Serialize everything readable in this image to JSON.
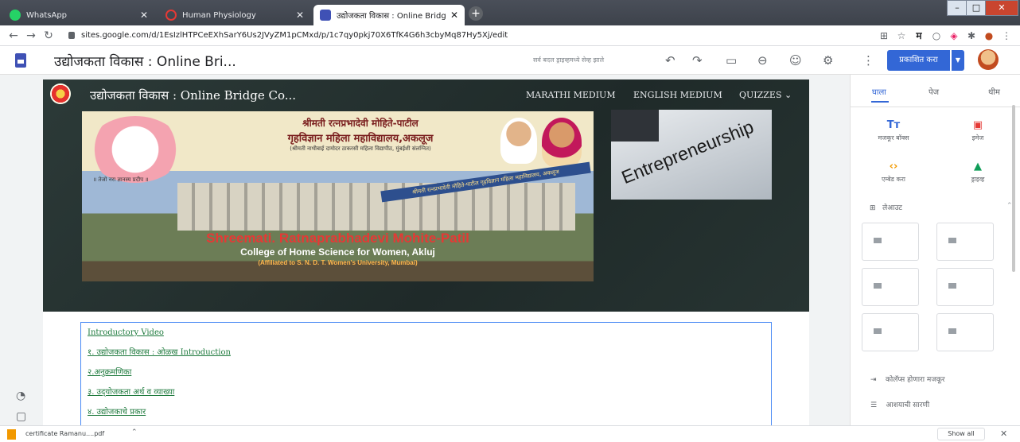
{
  "browser": {
    "tabs": [
      {
        "label": "WhatsApp",
        "color": "#25d366"
      },
      {
        "label": "Human Physiology",
        "color": "#e53935"
      },
      {
        "label": "उद्योजकता विकास : Online Bridge (",
        "color": "#3f51b5"
      }
    ],
    "new_tab": "+",
    "url": "sites.google.com/d/1EsIzlHTPCeEXhSarY6Us2JVyZM1pCMxd/p/1c7qy0pkj70X6TfK4G6h3cbyMq87Hy5Xj/edit",
    "ext_letter": "म"
  },
  "editor": {
    "title": "उद्योजकता विकास : Online Bri...",
    "save_status": "सर्व बदल ड्राइव्हमध्ये सेव्ह झाले",
    "publish_label": "प्रकाशित करा"
  },
  "site": {
    "title": "उद्योजकता विकास : Online Bridge Co...",
    "nav": [
      "MARATHI MEDIUM",
      "ENGLISH MEDIUM",
      "QUIZZES"
    ],
    "banner": {
      "hindi_line1": "श्रीमती रत्नप्रभादेवी मोहिते-पाटील",
      "hindi_line2": "गृहविज्ञान महिला महाविद्यालय,अकलूज",
      "hindi_line3": "(श्रीमती नाथीबाई दामोदर ठाकरसी महिला विद्यापीठ, मुंबईशी संलग्नित)",
      "seal_text": "॥ तेजो नरा ज्ञानस्य प्रदीप ॥",
      "ribbon": "श्रीमती रत्नप्रभादेवी मोहिते-पाटील गृहविज्ञान महिला महाविद्यालय, अकलूज",
      "english_line1": "Shreemati. Ratnaprabhadevi Mohite-Patil",
      "english_line2": "College of Home Science for Women, Akluj",
      "english_line3": "(Affiliated to S. N. D. T. Women's University, Mumbai)"
    },
    "side_image_text": "Entrepreneurship",
    "content_links": [
      "Introductory Video",
      "१. उद्योजकता विकास : ओळख Introduction",
      "२.अनुक्रमणिका",
      "३. उद्‌योजकता अर्थ व व्याख्या",
      "४. उद्योजकाचे प्रकार"
    ]
  },
  "panel": {
    "tabs": [
      "घाला",
      "पेज",
      "थीम"
    ],
    "insert": [
      {
        "label": "मजकूर बॉक्स",
        "glyph": "Tт",
        "color": "#3367d6"
      },
      {
        "label": "इमेज",
        "glyph": "▣",
        "color": "#e53935"
      },
      {
        "label": "एम्बेड करा",
        "glyph": "‹›",
        "color": "#f29900"
      },
      {
        "label": "ड्राइव्ह",
        "glyph": "▲",
        "color": "#0f9d58"
      }
    ],
    "layouts_label": "लेआउट",
    "footer": [
      "कोलॅप्स होणारा मजकूर",
      "आशयाची सारणी"
    ]
  },
  "download": {
    "file": "certificate Ramanu....pdf",
    "show_all": "Show all"
  }
}
